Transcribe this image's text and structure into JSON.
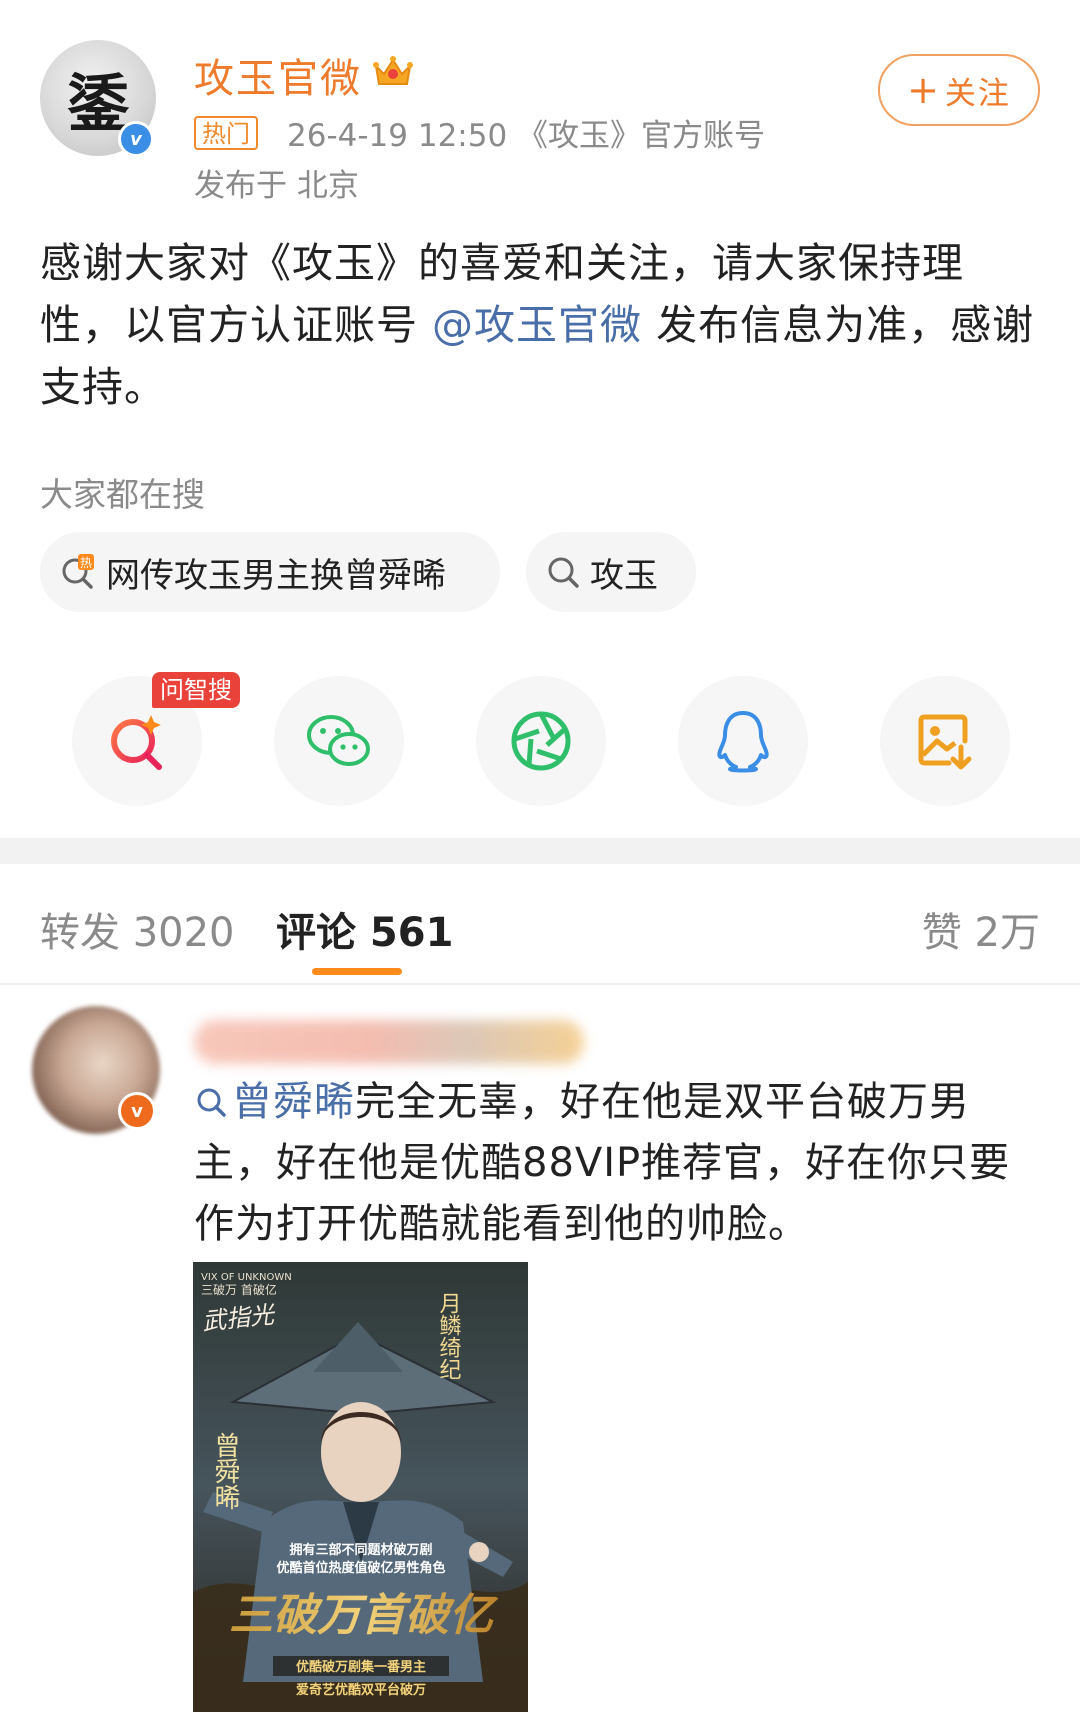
{
  "post": {
    "author": "攻玉官微",
    "avatar_glyph": "鋈",
    "hot_tag": "热门",
    "timestamp": "26-4-19 12:50",
    "source": "《攻玉》官方账号",
    "location": "发布于 北京",
    "follow_label": "关注",
    "follow_plus": "+",
    "text_before": "感谢大家对《攻玉》的喜爱和关注，请大家保持理性，以官方认证账号 ",
    "mention": "@攻玉官微",
    "text_after": " 发布信息为准，感谢支持。"
  },
  "search": {
    "title": "大家都在搜",
    "chips": [
      {
        "label": "网传攻玉男主换曾舜晞",
        "icon": "hot-search-icon"
      },
      {
        "label": "攻玉",
        "icon": "search-icon"
      }
    ]
  },
  "share": {
    "ai_badge": "问智搜",
    "items": [
      "ai-search-icon",
      "wechat-icon",
      "moments-icon",
      "qq-icon",
      "save-image-icon"
    ],
    "colors": {
      "ai": "#e8423a",
      "wechat": "#2fbf6b",
      "moments": "#2fbf6b",
      "qq": "#3a8ee6",
      "save": "#f0a020"
    }
  },
  "tabs": {
    "repost": "转发 3020",
    "comment": "评论 561",
    "like": "赞 2万"
  },
  "comment": {
    "link": "曾舜晞",
    "text": "完全无辜，好在他是双平台破万男主，好在他是优酷88VIP推荐官，好在你只要作为打开优酷就能看到他的帅脸。",
    "poster": {
      "top_en": "VIX OF UNKNOWN",
      "top_cn": "三破万 首破亿",
      "left_calligraphy": "武指光",
      "right_calligraphy": "月鳞绮纪",
      "name_vertical": "曾舜晞",
      "caption1": "拥有三部不同题材破万剧",
      "caption2": "优酷首位热度值破亿男性角色",
      "big_title": "三破万首破亿",
      "footer1": "优酷破万剧集一番男主",
      "footer2": "爱奇艺优酷双平台破万"
    }
  },
  "colors": {
    "accent_orange": "#ee7a2c",
    "link_blue": "#4a6ea8",
    "tab_indicator": "#ff8a1c",
    "verified_blue": "#3a8ee6"
  }
}
